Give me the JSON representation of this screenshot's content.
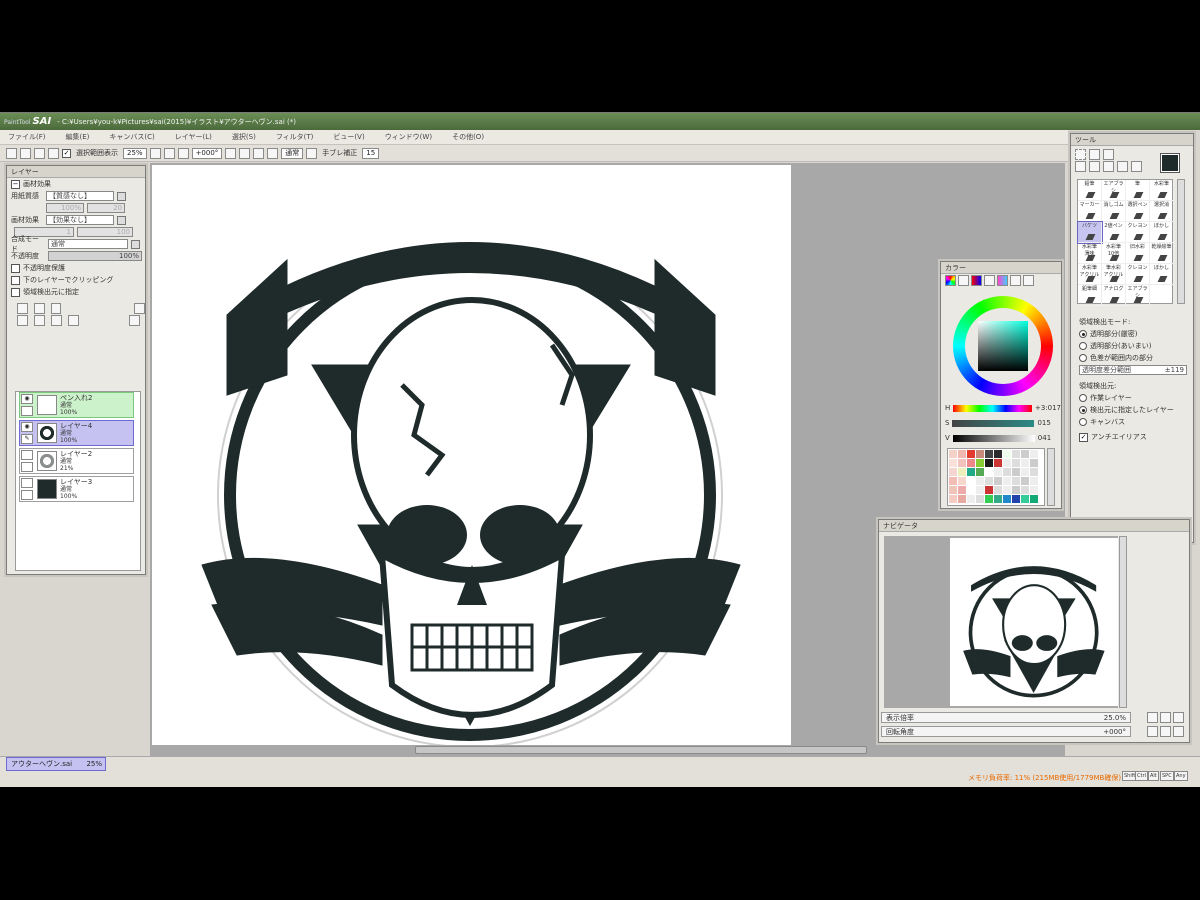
{
  "window": {
    "app_small": "PaintTool",
    "app_name": "SAI",
    "title_path": "- C:¥Users¥you-k¥Pictures¥sai(2015)¥イラスト¥アウターヘヴン.sai (*)"
  },
  "menu": [
    "ファイル(F)",
    "編集(E)",
    "キャンバス(C)",
    "レイヤー(L)",
    "選択(S)",
    "フィルタ(T)",
    "ビュー(V)",
    "ウィンドウ(W)",
    "その他(O)"
  ],
  "toolbar": {
    "selection_display_label": "選択範囲表示",
    "zoom": "25%",
    "rotation": "+000°",
    "blend": "通常",
    "stabilizer_label": "手ブレ補正",
    "stabilizer_value": "15"
  },
  "layer_panel": {
    "title": "レイヤー",
    "material_section": "画材効果",
    "paper_label": "用紙質感",
    "paper_value": "【質感なし】",
    "paper_scale": "100%",
    "paper_strength": "20",
    "effect_label": "画材効果",
    "effect_value": "【効果なし】",
    "effect_width": "1",
    "effect_strength": "100",
    "blend_mode_label": "合成モード",
    "blend_mode_value": "通常",
    "opacity_label": "不透明度",
    "opacity_value": "100%",
    "option_protect": "不透明度保護",
    "option_clip": "下のレイヤーでクリッピング",
    "option_area": "領域検出元に指定",
    "layers": [
      {
        "name": "ペン入れ2",
        "mode": "通常",
        "opacity": "100%"
      },
      {
        "name": "レイヤー4",
        "mode": "通常",
        "opacity": "100%"
      },
      {
        "name": "レイヤー2",
        "mode": "通常",
        "opacity": "21%"
      },
      {
        "name": "レイヤー3",
        "mode": "通常",
        "opacity": "100%"
      }
    ]
  },
  "color_panel": {
    "title": "カラー",
    "h_label": "H",
    "h_value": "+3:017",
    "s_label": "S",
    "s_value": "015",
    "v_label": "V",
    "v_value": "041",
    "swatch_colors": [
      "#f4d2c8",
      "#f0b8b0",
      "#e23a2c",
      "#c98a7a",
      "#444",
      "#2c2c2c",
      "#efe",
      "#ddd",
      "#ccc",
      "#eee",
      "#f9e0d8",
      "#f2c2bc",
      "#e88",
      "#8c3",
      "#1a1a1a",
      "#c33",
      "#eee",
      "#ddd",
      "#eee",
      "#ccc",
      "#f5d5cf",
      "#eeb",
      "#2a8",
      "#5a5",
      "#fff",
      "#eee",
      "#ddd",
      "#ccc",
      "#eee",
      "#ddd",
      "#f2bdb5",
      "#f7d6cc",
      "#fff",
      "#eee",
      "#ddd",
      "#ccc",
      "#eee",
      "#ddd",
      "#ccc",
      "#eee",
      "#efc4b9",
      "#eaa",
      "#fff",
      "#eee",
      "#c33",
      "#ddd",
      "#eee",
      "#ccc",
      "#ddd",
      "#eee",
      "#f5ccc4",
      "#e8aaa0",
      "#eee",
      "#ddd",
      "#3c5",
      "#3a8",
      "#28c",
      "#24a",
      "#3c9",
      "#1a7"
    ]
  },
  "navigator": {
    "title": "ナビゲータ",
    "zoom_label": "表示倍率",
    "zoom_value": "25.0%",
    "rotate_label": "回転角度",
    "rotate_value": "+000°"
  },
  "tool_panel": {
    "title": "ツール",
    "tools": [
      "鉛筆",
      "エアブラシ",
      "筆",
      "水彩筆",
      "マーカー",
      "消しゴム",
      "選択ペン",
      "選択消",
      "バケツ",
      "2値ペン",
      "クレヨン",
      "ぼかし",
      "水彩筆\n薄味",
      "水彩筆\n10倍",
      "旧水彩",
      "乾燥絵筆",
      "水彩筆\nアクリル",
      "筆水彩\nアクリル",
      "クレヨン",
      "ぼかし",
      "鉛筆細",
      "アナログ",
      "エアブラシ"
    ],
    "selected_tool": "バケツ",
    "detect_mode_label": "領域検出モード:",
    "detect_modes": [
      "透明部分(厳密)",
      "透明部分(あいまい)",
      "色差が範囲内の部分"
    ],
    "detect_range_label": "透明度差分範囲",
    "detect_range_value": "±119",
    "detect_source_label": "領域検出元:",
    "detect_sources": [
      "作業レイヤー",
      "検出元に指定したレイヤー",
      "キャンバス"
    ],
    "antialias_label": "アンチエイリアス"
  },
  "statusbar": {
    "doc_name": "アウターヘヴン.sai",
    "doc_zoom": "25%",
    "memory": "メモリ負荷率: 11% (215MB使用/1779MB確保)",
    "keys": [
      "Shift",
      "Ctrl",
      "Alt",
      "SPC",
      "Any"
    ]
  },
  "colors": {
    "emblem": "#1e2b2a",
    "accent": "#6e6ad2"
  }
}
